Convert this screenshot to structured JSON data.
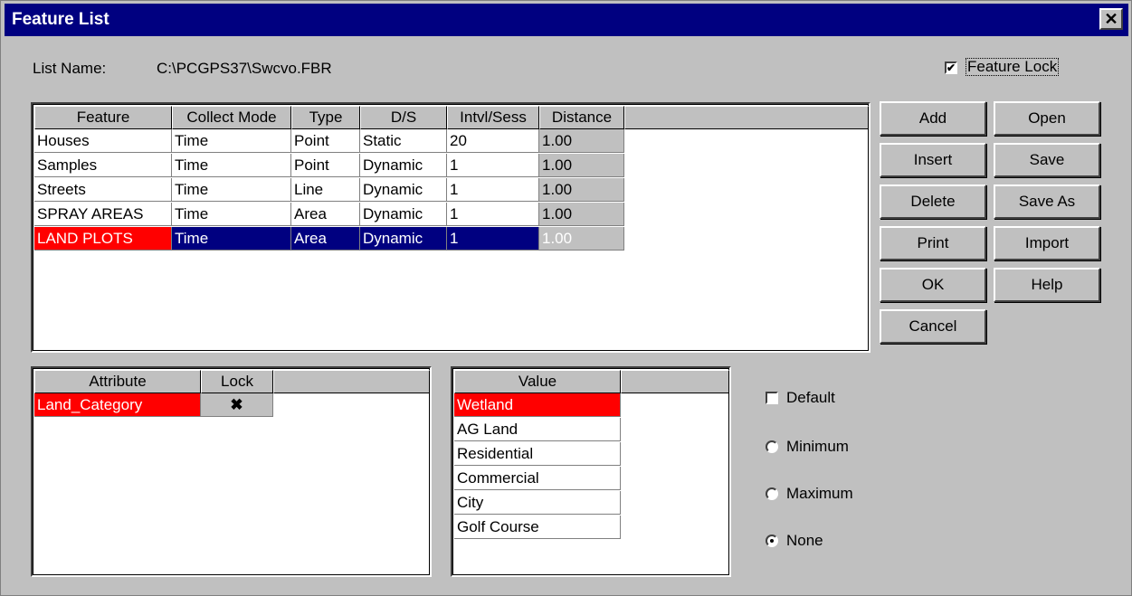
{
  "window": {
    "title": "Feature List",
    "close_glyph": "✕"
  },
  "list_name": {
    "label": "List Name:",
    "value": "C:\\PCGPS37\\Swcvo.FBR"
  },
  "feature_lock": {
    "label": "Feature Lock",
    "checked": true
  },
  "feature_table": {
    "columns": [
      "Feature",
      "Collect Mode",
      "Type",
      "D/S",
      "Intvl/Sess",
      "Distance"
    ],
    "rows": [
      [
        "Houses",
        "Time",
        "Point",
        "Static",
        "20",
        "1.00"
      ],
      [
        "Samples",
        "Time",
        "Point",
        "Dynamic",
        "1",
        "1.00"
      ],
      [
        "Streets",
        "Time",
        "Line",
        "Dynamic",
        "1",
        "1.00"
      ],
      [
        "SPRAY AREAS",
        "Time",
        "Area",
        "Dynamic",
        "1",
        "1.00"
      ],
      [
        "LAND PLOTS",
        "Time",
        "Area",
        "Dynamic",
        "1",
        "1.00"
      ]
    ],
    "selected_row": 4
  },
  "buttons": {
    "add": "Add",
    "open": "Open",
    "insert": "Insert",
    "save": "Save",
    "delete": "Delete",
    "save_as": "Save As",
    "print": "Print",
    "import": "Import",
    "ok": "OK",
    "help": "Help",
    "cancel": "Cancel"
  },
  "attribute_table": {
    "columns": [
      "Attribute",
      "Lock"
    ],
    "rows": [
      {
        "attribute": "Land_Category",
        "lock": "✖"
      }
    ]
  },
  "value_table": {
    "column": "Value",
    "rows": [
      "Wetland",
      "AG Land",
      "Residential",
      "Commercial",
      "City",
      "Golf Course"
    ],
    "selected_row": 0
  },
  "options": {
    "default_label": "Default",
    "default_checked": false,
    "radios": [
      {
        "label": "Minimum",
        "checked": false
      },
      {
        "label": "Maximum",
        "checked": false
      },
      {
        "label": "None",
        "checked": true
      }
    ]
  },
  "colors": {
    "title_bar": "#000080",
    "selection": "#000080",
    "highlight_red": "#ff0000",
    "face": "#c0c0c0"
  }
}
